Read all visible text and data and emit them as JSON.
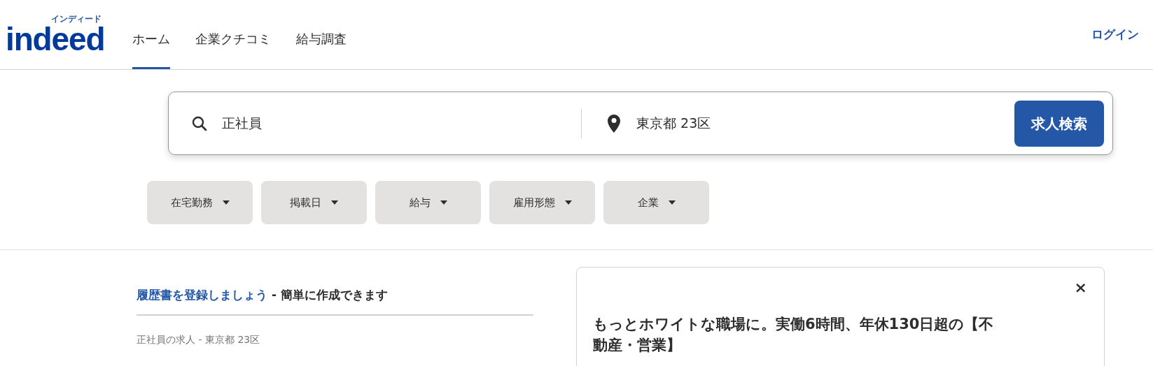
{
  "header": {
    "logo": {
      "wordmark": "indeed",
      "kana": "インディード"
    },
    "nav": [
      {
        "label": "ホーム",
        "selected": true
      },
      {
        "label": "企業クチコミ",
        "selected": false
      },
      {
        "label": "給与調査",
        "selected": false
      }
    ],
    "login": "ログイン"
  },
  "search": {
    "what": "正社員",
    "where": "東京都 23区",
    "button": "求人検索"
  },
  "filters": [
    "在宅勤務",
    "掲載日",
    "給与",
    "雇用形態",
    "企業"
  ],
  "resume_prompt": {
    "link": "履歴書を登録しましょう",
    "text": " - 簡単に作成できます"
  },
  "breadcrumb": "正社員の求人 - 東京都 23区",
  "promo": {
    "title": "もっとホワイトな職場に。実働6時間、年休130日超の【不動産・営業】",
    "close": "×"
  }
}
